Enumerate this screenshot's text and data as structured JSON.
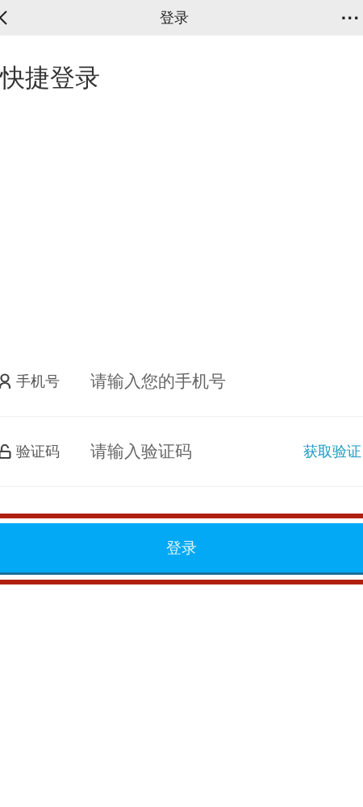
{
  "nav_bar": {
    "title": "登录",
    "more": "···"
  },
  "heading": "快捷登录",
  "fields": [
    {
      "kind": "phone",
      "label": "手机号",
      "placeholder": "请输入您的手机号"
    },
    {
      "kind": "code",
      "label": "验证码",
      "placeholder": "请输入验证码",
      "action": "获取验证"
    }
  ],
  "login_button": {
    "label": "登录",
    "highlighted": true
  }
}
